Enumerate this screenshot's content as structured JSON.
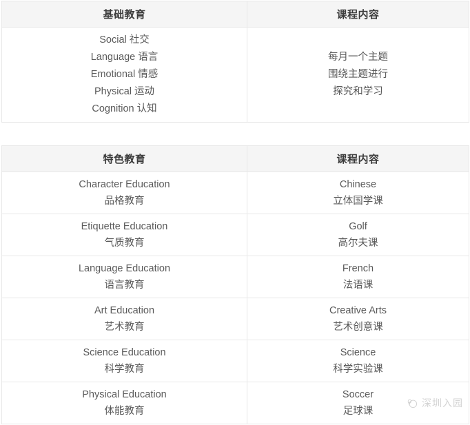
{
  "tables": [
    {
      "id": "basic-education",
      "headers": [
        "基础教育",
        "课程内容"
      ],
      "rows": [
        {
          "left": [
            "Social 社交",
            "Language 语言",
            "Emotional 情感",
            "Physical 运动",
            "Cognition 认知"
          ],
          "right": [
            "每月一个主题",
            "围绕主题进行",
            "探究和学习"
          ]
        }
      ]
    },
    {
      "id": "featured-education",
      "headers": [
        "特色教育",
        "课程内容"
      ],
      "rows": [
        {
          "left": [
            "Character Education",
            "品格教育"
          ],
          "right": [
            "Chinese",
            "立体国学课"
          ]
        },
        {
          "left": [
            "Etiquette Education",
            "气质教育"
          ],
          "right": [
            "Golf",
            "高尔夫课"
          ]
        },
        {
          "left": [
            "Language Education",
            "语言教育"
          ],
          "right": [
            "French",
            "法语课"
          ]
        },
        {
          "left": [
            "Art Education",
            "艺术教育"
          ],
          "right": [
            "Creative Arts",
            "艺术创意课"
          ]
        },
        {
          "left": [
            "Science Education",
            "科学教育"
          ],
          "right": [
            "Science",
            "科学实验课"
          ]
        },
        {
          "left": [
            "Physical Education",
            "体能教育"
          ],
          "right": [
            "Soccer",
            "足球课"
          ]
        }
      ]
    }
  ],
  "watermark": {
    "text": "深圳入园",
    "icon": "cloud-circle-icon"
  },
  "colors": {
    "header_background": "#f5f5f5",
    "header_text": "#3c3c3c",
    "body_text": "#5a5a5a",
    "border": "#e8e8e8",
    "page_background": "#ffffff",
    "watermark_text": "#8a8a8a"
  }
}
